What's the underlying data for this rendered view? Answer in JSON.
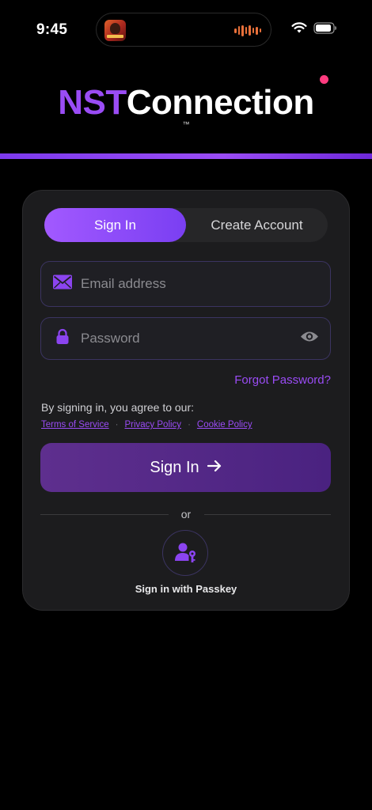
{
  "status_bar": {
    "time": "9:45",
    "icons": [
      "now-playing-artwork",
      "audio-waveform-icon",
      "wifi-icon",
      "battery-icon"
    ]
  },
  "logo": {
    "part1": "NST",
    "part2": "Connection",
    "tm": "™"
  },
  "colors": {
    "accent": "#9a4cf5",
    "dot": "#ff3b7f",
    "background": "#000000",
    "card": "#1c1c1e"
  },
  "tabs": {
    "sign_in": "Sign In",
    "create_account": "Create Account",
    "active": "Sign In"
  },
  "form": {
    "email_placeholder": "Email address",
    "email_value": "",
    "password_placeholder": "Password",
    "password_value": "",
    "forgot_password": "Forgot Password?"
  },
  "legal": {
    "agree_text": "By signing in, you agree to our:",
    "terms": "Terms of Service",
    "privacy": "Privacy Policy",
    "cookie": "Cookie Policy",
    "separator": "·"
  },
  "actions": {
    "sign_in_button": "Sign In",
    "or": "or",
    "passkey_label": "Sign in with Passkey"
  }
}
